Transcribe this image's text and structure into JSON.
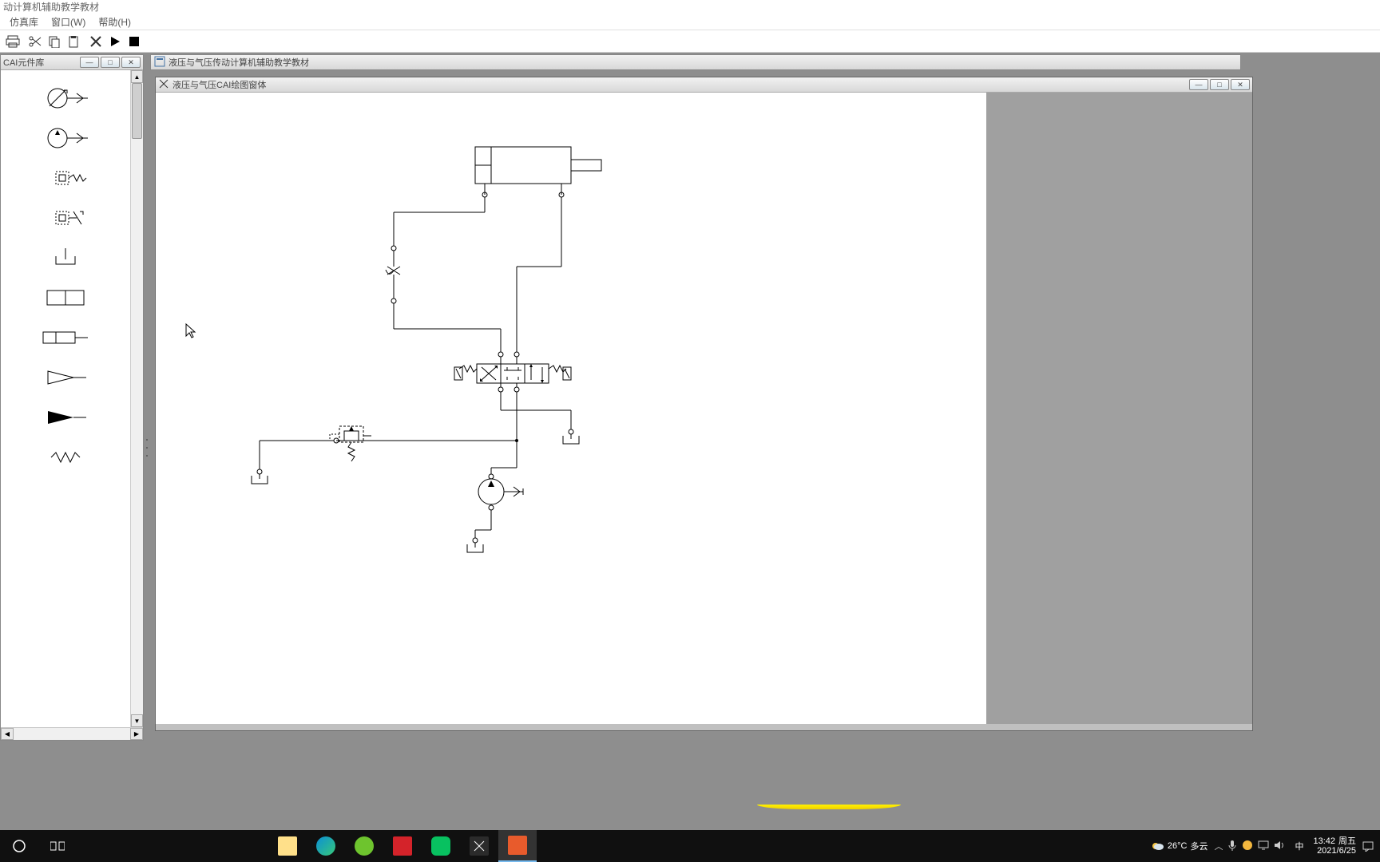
{
  "app": {
    "title": "动计算机辅助教学教材"
  },
  "menu": {
    "sim": "仿真库",
    "window": "窗口(W)",
    "help": "帮助(H)"
  },
  "toolbar_icons": {
    "print": "printer-icon",
    "cut": "scissors-icon",
    "copy": "copy-icon",
    "paste": "paste-icon",
    "tools": "tools-icon",
    "play": "play-icon",
    "stop": "stop-icon"
  },
  "palette": {
    "title": "CAI元件库",
    "items": [
      "variable-pump",
      "pump",
      "valve-spring",
      "valve-adjustable",
      "tank-symbol",
      "double-block",
      "cylinder",
      "amplifier-open",
      "amplifier-solid",
      "resistor-wave"
    ]
  },
  "doc_window": {
    "title": "液压与气压传动计算机辅助教学教材"
  },
  "canvas_window": {
    "title": "液压与气压CAI绘图窗体"
  },
  "taskbar": {
    "weather_temp": "26°C",
    "weather_text": "多云",
    "ime": "中",
    "time": "13:42",
    "day": "周五",
    "date": "2021/6/25"
  }
}
